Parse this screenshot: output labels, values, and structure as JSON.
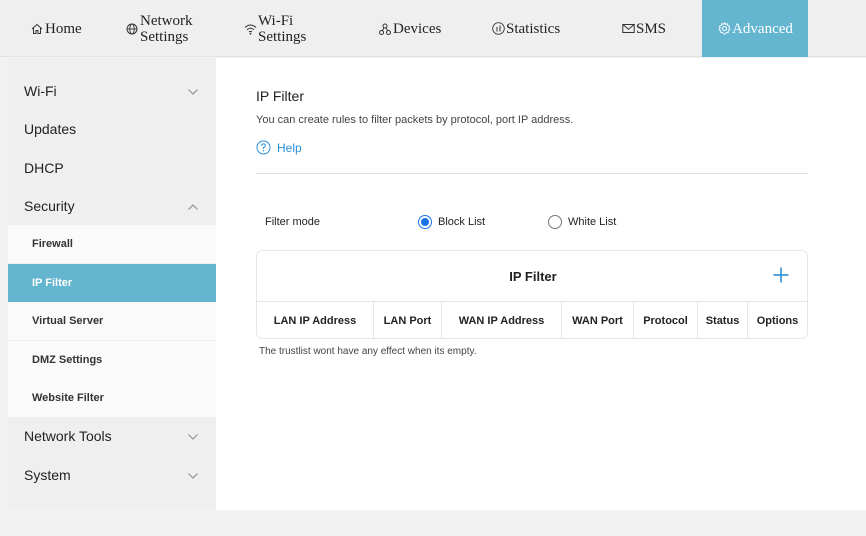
{
  "nav": {
    "items": [
      {
        "label": "Home",
        "icon": "home-icon"
      },
      {
        "label": "Network Settings",
        "icon": "globe-icon"
      },
      {
        "label": "Wi-Fi Settings",
        "icon": "wifi-icon"
      },
      {
        "label": "Devices",
        "icon": "devices-icon"
      },
      {
        "label": "Statistics",
        "icon": "statistics-icon"
      },
      {
        "label": "SMS",
        "icon": "envelope-icon"
      },
      {
        "label": "Advanced",
        "icon": "gear-icon"
      }
    ],
    "active_index": 6
  },
  "sidebar": {
    "items": [
      {
        "label": "Wi-Fi",
        "type": "group",
        "state": "collapsed"
      },
      {
        "label": "Updates",
        "type": "group"
      },
      {
        "label": "DHCP",
        "type": "group"
      },
      {
        "label": "Security",
        "type": "group",
        "state": "expanded"
      },
      {
        "label": "Firewall",
        "type": "sub"
      },
      {
        "label": "IP Filter",
        "type": "sub",
        "active": true
      },
      {
        "label": "Virtual Server",
        "type": "sub"
      },
      {
        "label": "DMZ Settings",
        "type": "sub"
      },
      {
        "label": "Website Filter",
        "type": "sub"
      },
      {
        "label": "Network Tools",
        "type": "group",
        "state": "collapsed"
      },
      {
        "label": "System",
        "type": "group",
        "state": "collapsed"
      }
    ]
  },
  "page": {
    "title": "IP Filter",
    "description": "You can create rules to filter packets by protocol, port IP address.",
    "help_label": "Help"
  },
  "filter_mode": {
    "label": "Filter mode",
    "options": [
      "Block List",
      "White List"
    ],
    "selected": "Block List"
  },
  "table": {
    "title": "IP Filter",
    "columns": [
      "LAN IP Address",
      "LAN Port",
      "WAN IP Address",
      "WAN Port",
      "Protocol",
      "Status",
      "Options"
    ],
    "rows": [],
    "note": "The trustlist wont have any effect when its empty."
  },
  "colors": {
    "accent": "#64b5d0",
    "link": "#2b8fd6",
    "radio": "#1a73e8"
  }
}
